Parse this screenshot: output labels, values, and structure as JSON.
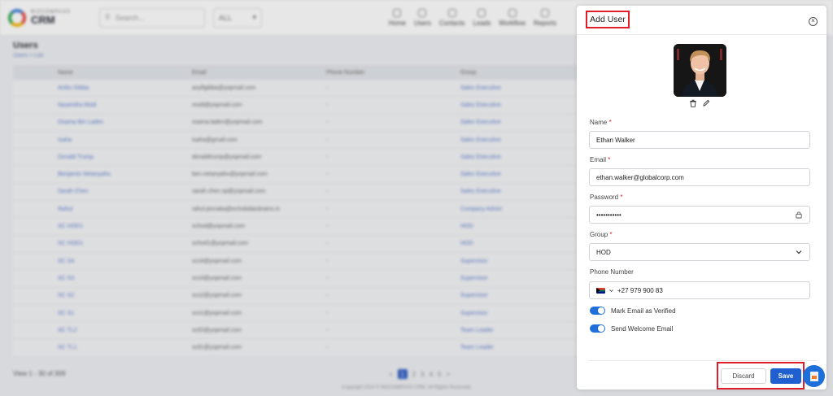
{
  "app": {
    "logo_small": "BIZCOMPASS",
    "logo_big": "CRM",
    "search_placeholder": "Search...",
    "filter_value": "ALL"
  },
  "nav": {
    "items": [
      {
        "label": "Home",
        "icon": "home-icon"
      },
      {
        "label": "Users",
        "icon": "user-icon"
      },
      {
        "label": "Contacts",
        "icon": "contacts-icon"
      },
      {
        "label": "Leads",
        "icon": "leads-icon"
      },
      {
        "label": "Workflow",
        "icon": "workflow-icon"
      },
      {
        "label": "Reports",
        "icon": "reports-icon"
      }
    ]
  },
  "page": {
    "title": "Users",
    "breadcrumb": "Users  >  List"
  },
  "table": {
    "headers": [
      "",
      "Name",
      "Email",
      "Phone Number",
      "Group"
    ],
    "rows": [
      {
        "name": "Aniko Gibba",
        "email": "anyflgibba@yopmail.com",
        "phone": "-",
        "group": "Sales Executive"
      },
      {
        "name": "Nasendra Modi",
        "email": "modi@yopmail.com",
        "phone": "-",
        "group": "Sales Executive"
      },
      {
        "name": "Osama Bin Laden",
        "email": "osama.laden@yopmail.com",
        "phone": "-",
        "group": "Sales Executive"
      },
      {
        "name": "Isaha",
        "email": "isaha@gmail.com",
        "phone": "-",
        "group": "Sales Executive"
      },
      {
        "name": "Donald Trump",
        "email": "donaldtrump@yopmail.com",
        "phone": "-",
        "group": "Sales Executive"
      },
      {
        "name": "Benjamin Netanyahu",
        "email": "ben.netanyahu@yopmail.com",
        "phone": "-",
        "group": "Sales Executive"
      },
      {
        "name": "Sarah Chen",
        "email": "sarah.chen.sp@yopmail.com",
        "phone": "-",
        "group": "Sales Executive"
      },
      {
        "name": "Rahul",
        "email": "rahul.pinnaka@echobidanbrains.in",
        "phone": "-",
        "group": "Company Admin"
      },
      {
        "name": "SC HOD1",
        "email": "schod@yopmail.com",
        "phone": "-",
        "group": "HOD"
      },
      {
        "name": "SC HOD1",
        "email": "schod1@yopmail.com",
        "phone": "-",
        "group": "HOD"
      },
      {
        "name": "SC S4",
        "email": "scs4@yopmail.com",
        "phone": "-",
        "group": "Supervisor"
      },
      {
        "name": "SC S3",
        "email": "scs3@yopmail.com",
        "phone": "-",
        "group": "Supervisor"
      },
      {
        "name": "SC S2",
        "email": "scs2@yopmail.com",
        "phone": "-",
        "group": "Supervisor"
      },
      {
        "name": "SC S1",
        "email": "scs1@yopmail.com",
        "phone": "-",
        "group": "Supervisor"
      },
      {
        "name": "SC TL2",
        "email": "sctl2@yopmail.com",
        "phone": "-",
        "group": "Team Leader"
      },
      {
        "name": "SC TL1",
        "email": "sctl1@yopmail.com",
        "phone": "-",
        "group": "Team Leader"
      }
    ]
  },
  "pagination": {
    "summary": "View 1 - 30 of 309",
    "pages": [
      "1",
      "2",
      "3",
      "4",
      "5"
    ],
    "current": "1",
    "prev": "<",
    "next": ">",
    "copyright": "Copyright 2024 © BIZCOMPASS CRM. All Rights Reserved."
  },
  "drawer": {
    "title": "Add User",
    "close_icon": "close-icon",
    "avatar_icon": "user-avatar",
    "delete_icon": "trash-icon",
    "edit_icon": "pencil-icon",
    "name_label": "Name",
    "name_value": "Ethan Walker",
    "email_label": "Email",
    "email_value": "ethan.walker@globalcorp.com",
    "password_label": "Password",
    "password_value": "•••••••••••",
    "lock_icon": "lock-icon",
    "group_label": "Group",
    "group_value": "HOD",
    "phone_label": "Phone Number",
    "phone_flag": "south-africa-flag",
    "phone_value": "+27 979 900 83",
    "required_mark": "*",
    "toggle_verified_label": "Mark Email as Verified",
    "toggle_verified_on": true,
    "toggle_welcome_label": "Send Welcome Email",
    "toggle_welcome_on": true,
    "discard_label": "Discard",
    "save_label": "Save"
  },
  "fab": {
    "icon": "document-icon"
  },
  "colors": {
    "primary": "#1f5fcf",
    "toggle": "#1e6fd9",
    "highlight": "#e11d2a",
    "required": "#e11d2a"
  }
}
